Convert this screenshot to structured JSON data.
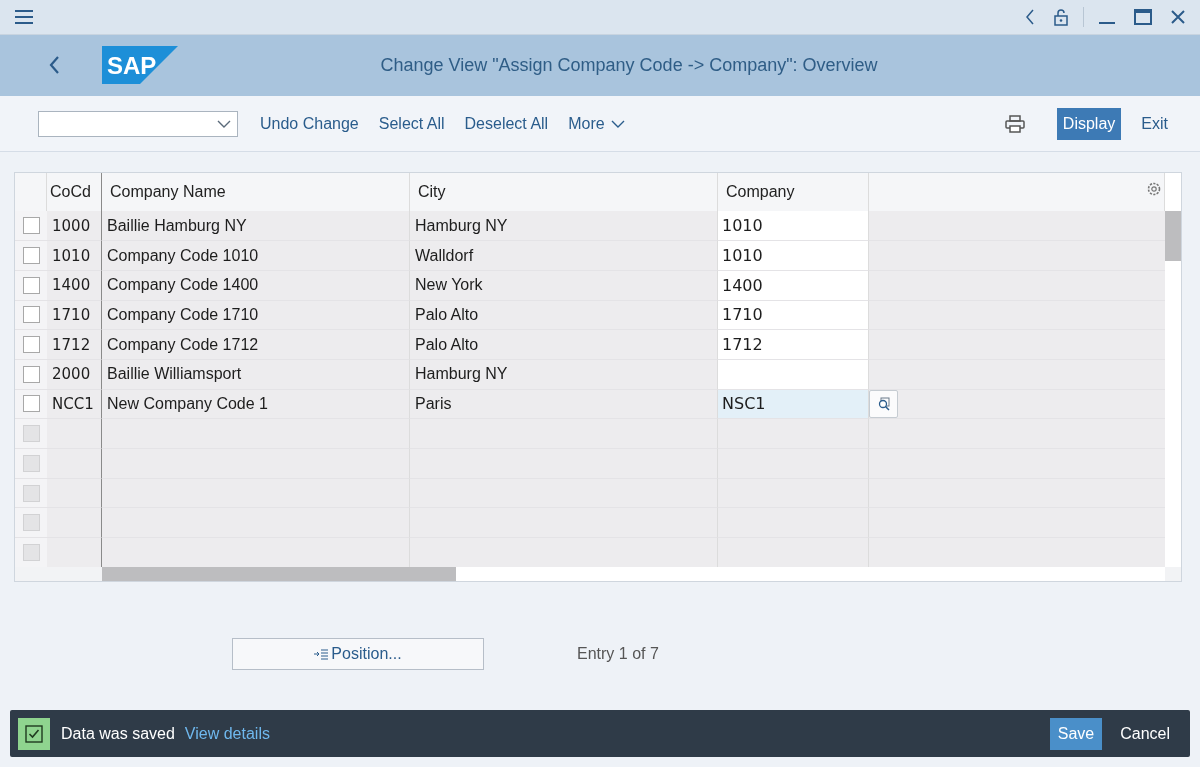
{
  "header": {
    "logo": "SAP",
    "title": "Change View \"Assign Company Code -> Company\": Overview"
  },
  "toolbar": {
    "actions": [
      {
        "label": "Undo Change",
        "kind": "link",
        "selected": false
      },
      {
        "label": "Select All",
        "kind": "link",
        "selected": false
      },
      {
        "label": "Deselect All",
        "kind": "link",
        "selected": false
      },
      {
        "label": "More",
        "kind": "menu",
        "selected": false
      }
    ],
    "right_actions": [
      {
        "label": "Display",
        "selected": true
      },
      {
        "label": "Exit",
        "selected": false
      }
    ]
  },
  "table": {
    "columns": [
      "CoCd",
      "Company Name",
      "City",
      "Company"
    ],
    "rows": [
      {
        "kind": "data",
        "checked": false,
        "cocd": "1000",
        "name": "Baillie Hamburg NY",
        "city": "Hamburg NY",
        "company": "1010",
        "focused": false,
        "disabled": false
      },
      {
        "kind": "data",
        "checked": false,
        "cocd": "1010",
        "name": "Company Code 1010",
        "city": "Walldorf",
        "company": "1010",
        "focused": false,
        "disabled": false
      },
      {
        "kind": "data",
        "checked": false,
        "cocd": "1400",
        "name": "Company Code 1400",
        "city": "New York",
        "company": "1400",
        "focused": false,
        "disabled": false
      },
      {
        "kind": "data",
        "checked": false,
        "cocd": "1710",
        "name": "Company Code 1710",
        "city": "Palo Alto",
        "company": "1710",
        "focused": false,
        "disabled": false
      },
      {
        "kind": "data",
        "checked": false,
        "cocd": "1712",
        "name": "Company Code 1712",
        "city": "Palo Alto",
        "company": "1712",
        "focused": false,
        "disabled": false
      },
      {
        "kind": "data",
        "checked": false,
        "cocd": "2000",
        "name": "Baillie Williamsport",
        "city": "Hamburg NY",
        "focused": false,
        "disabled": false
      },
      {
        "kind": "data",
        "checked": false,
        "cocd": "NCC1",
        "name": "New Company Code 1",
        "city": "Paris",
        "company": "NSC1",
        "focused": true,
        "disabled": false
      },
      {
        "kind": "blank",
        "checked": false,
        "disabled": true
      },
      {
        "kind": "blank",
        "checked": false,
        "disabled": true
      },
      {
        "kind": "blank",
        "checked": false,
        "disabled": true
      },
      {
        "kind": "blank",
        "checked": false,
        "disabled": true
      },
      {
        "kind": "blank",
        "checked": false,
        "disabled": true
      }
    ]
  },
  "position_button": "Position...",
  "entry_info": "Entry 1 of 7",
  "message_bar": {
    "text": "Data was saved",
    "link": "View details",
    "buttons": [
      {
        "label": "Save",
        "kind": "primary"
      },
      {
        "label": "Cancel",
        "kind": "plain"
      }
    ]
  }
}
